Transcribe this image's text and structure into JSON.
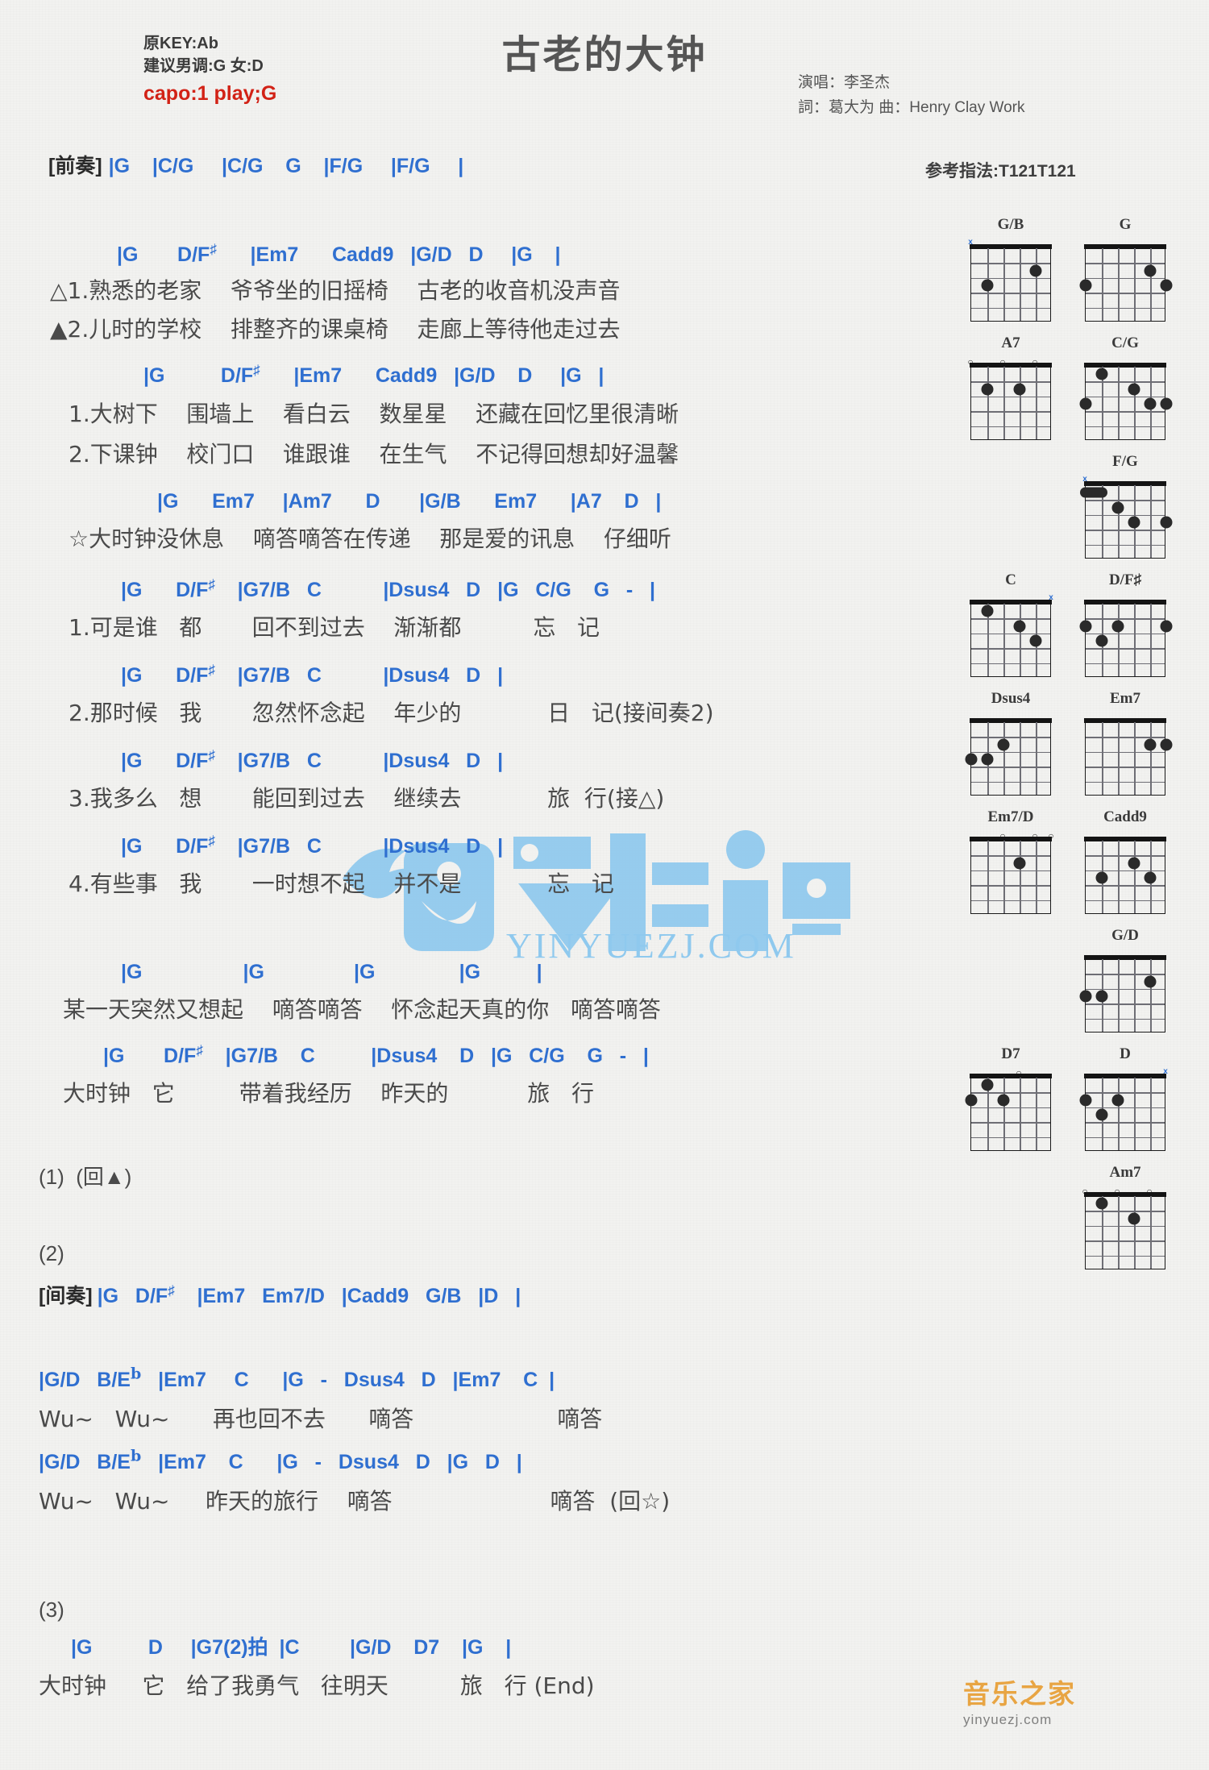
{
  "header": {
    "key_line": "原KEY:Ab",
    "suggest_line": "建议男调:G 女:D",
    "capo_line": "capo:1 play;G",
    "capo_color": "#d22216",
    "title": "古老的大钟",
    "singer": "演唱：李圣杰",
    "credits": "詞：葛大为  曲：Henry Clay Work",
    "fingering": "参考指法:T121T121"
  },
  "sections": {
    "intro_label": "[前奏]",
    "intro_chords": "|G    |C/G     |C/G    G    |F/G     |F/G     |",
    "interlude_label": "[间奏]",
    "interlude_chords": "|G   D/F#    |Em7   Em7/D   |Cadd9   G/B   |D   |",
    "mark1": "(1)  (回▲)",
    "mark2": "(2)",
    "mark3": "(3)"
  },
  "verse_a": {
    "chords": "|G       D/F#      |Em7      Cadd9   |G/D   D     |G    |",
    "lyric1": "△1.熟悉的老家    爷爷坐的旧摇椅    古老的收音机没声音",
    "lyric2": "▲2.儿时的学校    排整齐的课桌椅    走廊上等待他走过去"
  },
  "verse_b": {
    "chords": "|G          D/F#      |Em7      Cadd9   |G/D    D     |G   |",
    "lyric1": "1.大树下    围墙上    看白云    数星星    还藏在回忆里很清晰",
    "lyric2": "2.下课钟    校门口    谁跟谁    在生气    不记得回想却好温馨"
  },
  "chorus": {
    "chords": "|G      Em7     |Am7      D       |G/B      Em7      |A7    D   |",
    "lyric": "☆大时钟没休息    嘀答嘀答在传递    那是爱的讯息    仔细听"
  },
  "bridge1": {
    "chords": "|G      D/F#    |G7/B   C           |Dsus4   D   |G   C/G    G   -   |",
    "lyric": "1.可是谁   都       回不到过去    渐渐都          忘   记"
  },
  "bridge2": {
    "chords": "|G      D/F#    |G7/B   C           |Dsus4   D   |",
    "lyric": "2.那时候   我       忽然怀念起    年少的            日   记(接间奏2)"
  },
  "bridge3": {
    "chords": "|G      D/F#    |G7/B   C           |Dsus4   D   |",
    "lyric": "3.我多么   想       能回到过去    继续去            旅  行(接△)"
  },
  "bridge4": {
    "chords": "|G      D/F#    |G7/B   C           |Dsus4   D   |",
    "lyric": "4.有些事   我       一时想不起    并不是            忘   记"
  },
  "tick": {
    "chords": "|G                  |G                |G               |G          |",
    "lyric": "某一天突然又想起    嘀答嘀答    怀念起天真的你   嘀答嘀答"
  },
  "clock_line": {
    "chords": "|G       D/F#    |G7/B    C          |Dsus4    D   |G   C/G    G   -   |",
    "lyric": "大时钟   它         带着我经历    昨天的           旅   行"
  },
  "wu1": {
    "chords": "|G/D   B/Eb   |Em7     C      |G   -   Dsus4   D   |Em7    C  |",
    "lyric": "Wu~   Wu~      再也回不去      嘀答                    嘀答"
  },
  "wu2": {
    "chords": "|G/D   B/Eb   |Em7    C      |G   -   Dsus4   D   |G   D   |",
    "lyric": "Wu~   Wu~     昨天的旅行    嘀答                      嘀答  (回☆)"
  },
  "ending": {
    "chords": "|G          D     |G7(2)拍  |C         |G/D    D7    |G    |",
    "lyric": "大时钟     它   给了我勇气   往明天          旅   行 (End)"
  },
  "chord_diagrams": [
    {
      "name": "G/B",
      "open": [
        {
          "s": 0,
          "t": "x"
        }
      ],
      "dots": [
        {
          "s": 4,
          "f": 2
        },
        {
          "s": 1,
          "f": 3
        }
      ],
      "barres": []
    },
    {
      "name": "G",
      "open": [],
      "dots": [
        {
          "s": 4,
          "f": 2
        },
        {
          "s": 5,
          "f": 3
        },
        {
          "s": 0,
          "f": 3
        }
      ],
      "barres": []
    },
    {
      "name": "A7",
      "open": [
        {
          "s": 4,
          "t": "o"
        },
        {
          "s": 2,
          "t": "o"
        },
        {
          "s": 0,
          "t": "o"
        }
      ],
      "dots": [
        {
          "s": 3,
          "f": 2
        },
        {
          "s": 1,
          "f": 2
        }
      ],
      "barres": []
    },
    {
      "name": "C/G",
      "open": [],
      "dots": [
        {
          "s": 0,
          "f": 3
        },
        {
          "s": 5,
          "f": 3
        },
        {
          "s": 4,
          "f": 3
        },
        {
          "s": 3,
          "f": 2
        },
        {
          "s": 1,
          "f": 1
        }
      ],
      "barres": []
    },
    {
      "name": "F/G",
      "open": [
        {
          "s": 0,
          "t": "x"
        }
      ],
      "dots": [
        {
          "s": 5,
          "f": 3
        },
        {
          "s": 3,
          "f": 3
        },
        {
          "s": 2,
          "f": 2
        }
      ],
      "barres": [
        {
          "f": 1,
          "from": 0,
          "to": 1
        }
      ]
    },
    {
      "name": "C",
      "open": [
        {
          "s": 5,
          "t": "x"
        }
      ],
      "dots": [
        {
          "s": 4,
          "f": 3
        },
        {
          "s": 3,
          "f": 2
        },
        {
          "s": 1,
          "f": 1
        }
      ],
      "barres": []
    },
    {
      "name": "D/F#",
      "open": [],
      "dots": [
        {
          "s": 5,
          "f": 2
        },
        {
          "s": 2,
          "f": 2
        },
        {
          "s": 1,
          "f": 3
        },
        {
          "s": 0,
          "f": 2
        }
      ],
      "barres": []
    },
    {
      "name": "Dsus4",
      "open": [],
      "dots": [
        {
          "s": 2,
          "f": 2
        },
        {
          "s": 1,
          "f": 3
        },
        {
          "s": 0,
          "f": 3
        }
      ],
      "barres": []
    },
    {
      "name": "Em7",
      "open": [],
      "dots": [
        {
          "s": 5,
          "f": 2
        },
        {
          "s": 4,
          "f": 2
        }
      ],
      "barres": []
    },
    {
      "name": "Em7/D",
      "open": [
        {
          "s": 5,
          "t": "o"
        },
        {
          "s": 4,
          "t": "o"
        },
        {
          "s": 2,
          "t": "o"
        }
      ],
      "dots": [
        {
          "s": 3,
          "f": 2
        }
      ],
      "barres": []
    },
    {
      "name": "Cadd9",
      "open": [],
      "dots": [
        {
          "s": 4,
          "f": 3
        },
        {
          "s": 3,
          "f": 2
        },
        {
          "s": 1,
          "f": 3
        }
      ],
      "barres": []
    },
    {
      "name": "G/D",
      "open": [],
      "dots": [
        {
          "s": 4,
          "f": 2
        },
        {
          "s": 1,
          "f": 3
        },
        {
          "s": 0,
          "f": 3
        }
      ],
      "barres": []
    },
    {
      "name": "D7",
      "open": [
        {
          "s": 3,
          "t": "o"
        }
      ],
      "dots": [
        {
          "s": 1,
          "f": 1
        },
        {
          "s": 2,
          "f": 2
        },
        {
          "s": 0,
          "f": 2
        }
      ],
      "barres": []
    },
    {
      "name": "D",
      "open": [
        {
          "s": 5,
          "t": "x"
        }
      ],
      "dots": [
        {
          "s": 2,
          "f": 2
        },
        {
          "s": 0,
          "f": 2
        },
        {
          "s": 1,
          "f": 3
        }
      ],
      "barres": []
    },
    {
      "name": "Am7",
      "open": [
        {
          "s": 4,
          "t": "o"
        },
        {
          "s": 2,
          "t": "o"
        },
        {
          "s": 0,
          "t": "o"
        }
      ],
      "dots": [
        {
          "s": 1,
          "f": 1
        },
        {
          "s": 3,
          "f": 2
        }
      ],
      "barres": []
    }
  ],
  "watermark": {
    "center_text": "YINYUEZJ.COM",
    "brand_cn": "音乐之家",
    "brand_en": "yinyuezj.com"
  }
}
